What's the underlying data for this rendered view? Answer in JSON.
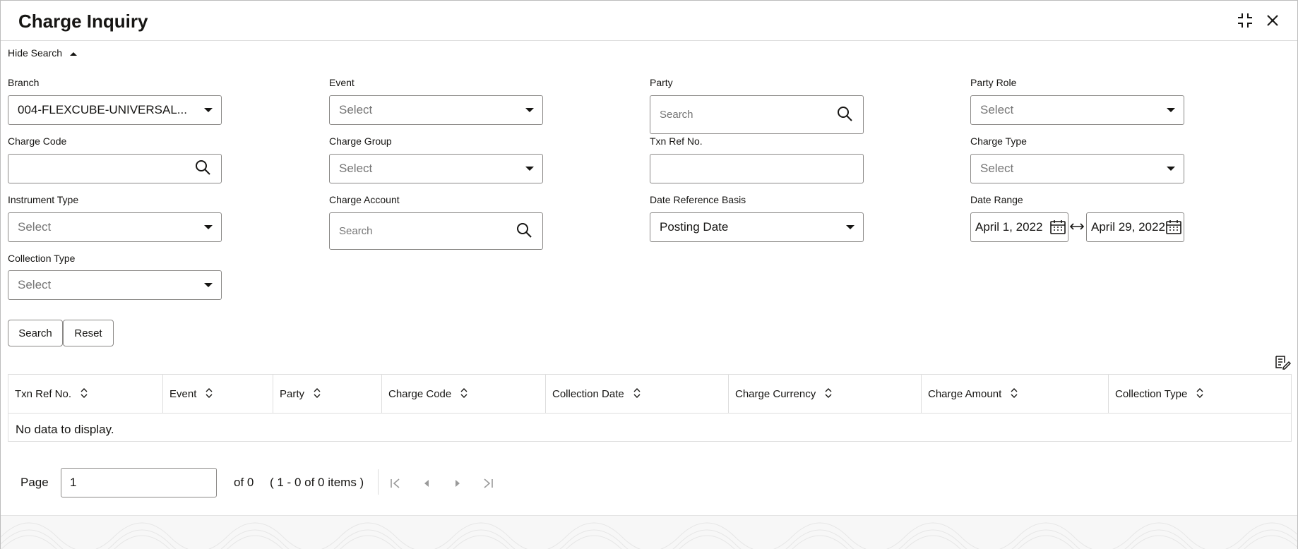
{
  "window": {
    "title": "Charge Inquiry",
    "maximize_icon": "collapse-corners-icon",
    "close_icon": "close-icon"
  },
  "search_toggle": {
    "label": "Hide Search",
    "icon": "caret-up-icon"
  },
  "fields": {
    "branch": {
      "label": "Branch",
      "value": "004-FLEXCUBE-UNIVERSAL..."
    },
    "event": {
      "label": "Event",
      "placeholder": "Select"
    },
    "party": {
      "label": "Party",
      "placeholder": "Search"
    },
    "party_role": {
      "label": "Party Role",
      "placeholder": "Select"
    },
    "charge_code": {
      "label": "Charge Code",
      "value": ""
    },
    "charge_group": {
      "label": "Charge Group",
      "placeholder": "Select"
    },
    "txn_ref_no": {
      "label": "Txn Ref No.",
      "value": ""
    },
    "charge_type": {
      "label": "Charge Type",
      "placeholder": "Select"
    },
    "instrument_type": {
      "label": "Instrument Type",
      "placeholder": "Select"
    },
    "charge_account": {
      "label": "Charge Account",
      "placeholder": "Search"
    },
    "date_reference_basis": {
      "label": "Date Reference Basis",
      "value": "Posting Date"
    },
    "date_range": {
      "label": "Date Range",
      "from": "April 1, 2022",
      "to": "April 29, 2022"
    },
    "collection_type": {
      "label": "Collection Type",
      "placeholder": "Select"
    }
  },
  "actions": {
    "search": "Search",
    "reset": "Reset"
  },
  "grid": {
    "columns": [
      "Txn Ref No.",
      "Event",
      "Party",
      "Charge Code",
      "Collection Date",
      "Charge Currency",
      "Charge Amount",
      "Collection Type"
    ],
    "empty_message": "No data to display."
  },
  "pager": {
    "page_label": "Page",
    "page_value": "1",
    "of_label": "of 0",
    "items_label": "( 1 - 0 of 0 items )"
  },
  "colors": {
    "border": "#8a8886",
    "text": "#161513",
    "placeholder": "#757575"
  }
}
